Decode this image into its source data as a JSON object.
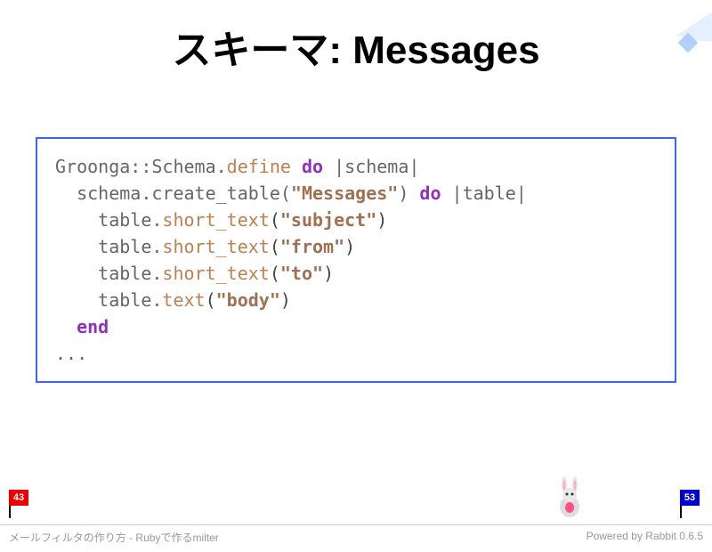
{
  "title": "スキーマ: Messages",
  "code": {
    "l1": {
      "a": "Groonga::Schema",
      "b": ".",
      "c": "define",
      "d": " ",
      "e": "do",
      "f": " |schema|"
    },
    "l2": {
      "a": "  schema.create_table(",
      "b": "\"Messages\"",
      "c": ") ",
      "d": "do",
      "e": " |table|"
    },
    "l3": {
      "a": "    table.",
      "b": "short_text",
      "c": "(",
      "d": "\"subject\"",
      "e": ")"
    },
    "l4": {
      "a": "    table.",
      "b": "short_text",
      "c": "(",
      "d": "\"from\"",
      "e": ")"
    },
    "l5": {
      "a": "    table.",
      "b": "short_text",
      "c": "(",
      "d": "\"to\"",
      "e": ")"
    },
    "l6": {
      "a": "    table.",
      "b": "text",
      "c": "(",
      "d": "\"body\"",
      "e": ")"
    },
    "l7": {
      "a": "  ",
      "b": "end"
    },
    "l8": {
      "a": "..."
    }
  },
  "progress": {
    "current": "43",
    "total": "53"
  },
  "footer": {
    "left": "メールフィルタの作り方 - Rubyで作るmilter",
    "right": "Powered by Rabbit 0.6.5"
  }
}
